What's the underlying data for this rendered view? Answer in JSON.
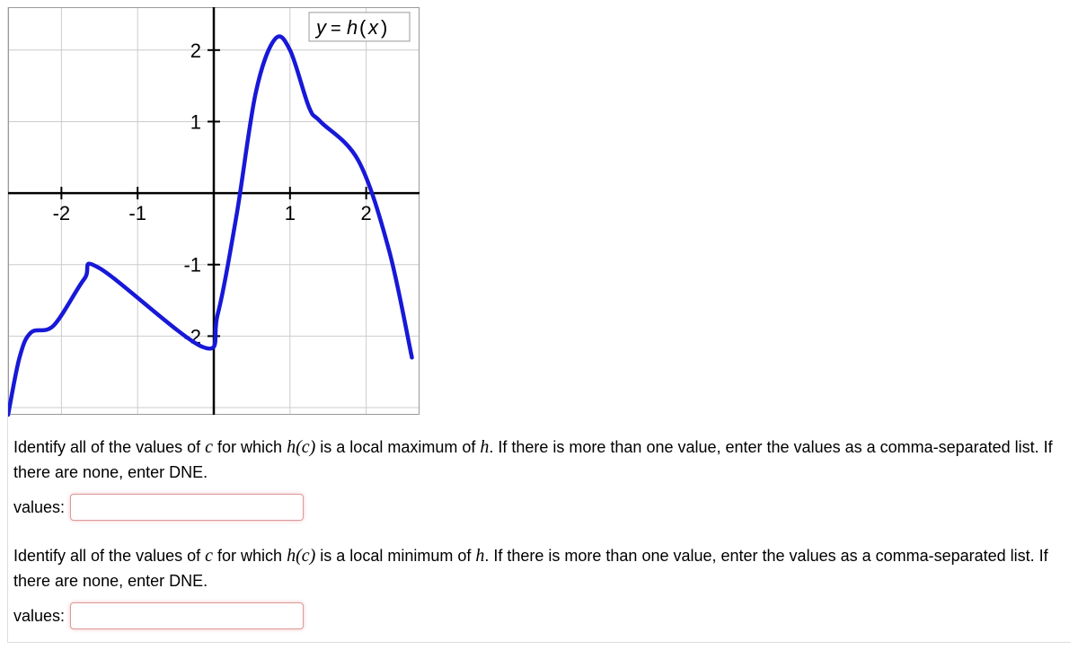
{
  "chart_data": {
    "type": "line",
    "title": "",
    "function_label": "y = h(x)",
    "xlabel": "",
    "ylabel": "",
    "xlim": [
      -2.7,
      2.7
    ],
    "ylim": [
      -3.1,
      2.6
    ],
    "x_ticks": [
      -2,
      -1,
      1,
      2
    ],
    "y_ticks": [
      -2,
      -1,
      1,
      2
    ],
    "series": [
      {
        "name": "h(x)",
        "points": [
          [
            -2.7,
            -3.1
          ],
          [
            -2.55,
            -2.3
          ],
          [
            -2.4,
            -1.95
          ],
          [
            -2.1,
            -1.85
          ],
          [
            -1.7,
            -1.2
          ],
          [
            -1.5,
            -1.05
          ],
          [
            -0.15,
            -2.15
          ],
          [
            0.05,
            -1.7
          ],
          [
            0.3,
            -0.3
          ],
          [
            0.55,
            1.4
          ],
          [
            0.8,
            2.15
          ],
          [
            1.0,
            2.0
          ],
          [
            1.25,
            1.2
          ],
          [
            1.4,
            1.0
          ],
          [
            1.9,
            0.45
          ],
          [
            2.3,
            -0.8
          ],
          [
            2.6,
            -2.3
          ]
        ]
      }
    ]
  },
  "q1": {
    "prefix": "Identify all of the values of ",
    "c": "c",
    "middle": " for which ",
    "hc": "h(c)",
    "is_local": " is a local maximum of ",
    "h": "h",
    "suffix": ". If there is more than one value, enter the values as a comma-separated list. If there are none, enter DNE.",
    "label": "values:",
    "value": ""
  },
  "q2": {
    "prefix": "Identify all of the values of ",
    "c": "c",
    "middle": " for which ",
    "hc": "h(c)",
    "is_local": " is a local minimum of ",
    "h": "h",
    "suffix": ". If there is more than one value, enter the values as a comma-separated list. If there are none, enter DNE.",
    "label": "values:",
    "value": ""
  }
}
